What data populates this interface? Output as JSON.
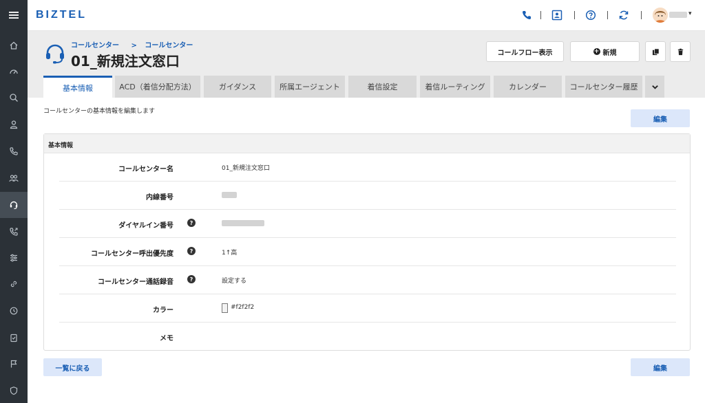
{
  "app": {
    "logo": "BIZTEL"
  },
  "breadcrumb": {
    "first": "コールセンター",
    "separator": ">",
    "second": "コールセンター"
  },
  "page_title": "01_新規注文窓口",
  "actions": {
    "callflow": "コールフロー表示",
    "new": "新規"
  },
  "tabs": [
    {
      "label": "基本情報"
    },
    {
      "label": "ACD（着信分配方法）"
    },
    {
      "label": "ガイダンス"
    },
    {
      "label": "所属エージェント"
    },
    {
      "label": "着信設定"
    },
    {
      "label": "着信ルーティング"
    },
    {
      "label": "カレンダー"
    },
    {
      "label": "コールセンター履歴"
    }
  ],
  "description": "コールセンターの基本情報を編集します",
  "edit_label": "編集",
  "back_label": "一覧に戻る",
  "card": {
    "title": "基本情報",
    "rows": [
      {
        "label": "コールセンター名",
        "value": "01_新規注文窓口"
      },
      {
        "label": "内線番号",
        "value": ""
      },
      {
        "label": "ダイヤルイン番号",
        "value": ""
      },
      {
        "label": "コールセンター呼出優先度",
        "value": "1↑高"
      },
      {
        "label": "コールセンター通話録音",
        "value": "設定する"
      },
      {
        "label": "カラー",
        "value": "#f2f2f2"
      },
      {
        "label": "メモ",
        "value": ""
      }
    ],
    "help_glyph": "?"
  },
  "colors": {
    "accent": "#1a5fb4",
    "sidebar": "#2b3137",
    "swatch": "#f2f2f2"
  }
}
